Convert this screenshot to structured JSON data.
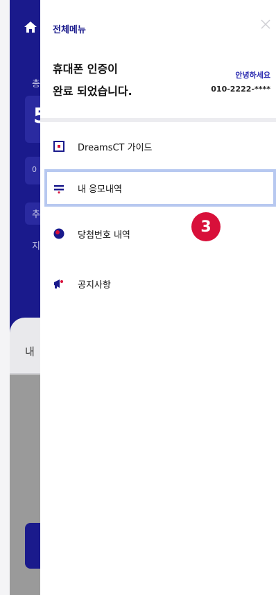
{
  "background": {
    "home_icon": "home-icon",
    "chars": [
      "총",
      "5",
      "0",
      "추",
      "지"
    ],
    "lower_char": "내"
  },
  "menu": {
    "title": "전체메뉴",
    "close_icon": "close-icon",
    "auth_line1": "휴대폰 인증이",
    "auth_line2": "완료 되었습니다.",
    "greeting": "안녕하세요",
    "phone": "010-2222-****",
    "items": [
      {
        "label": "DreamsCT 가이드",
        "icon": "guide-icon"
      },
      {
        "label": "내 응모내역",
        "icon": "list-icon"
      },
      {
        "label": "당첨번호 내역",
        "icon": "ball-icon"
      },
      {
        "label": "공지사항",
        "icon": "megaphone-icon"
      }
    ],
    "step_badge": "3"
  },
  "colors": {
    "brand": "#1a1a8c",
    "accent_red": "#d8103a",
    "highlight": "#b7c8f0"
  }
}
